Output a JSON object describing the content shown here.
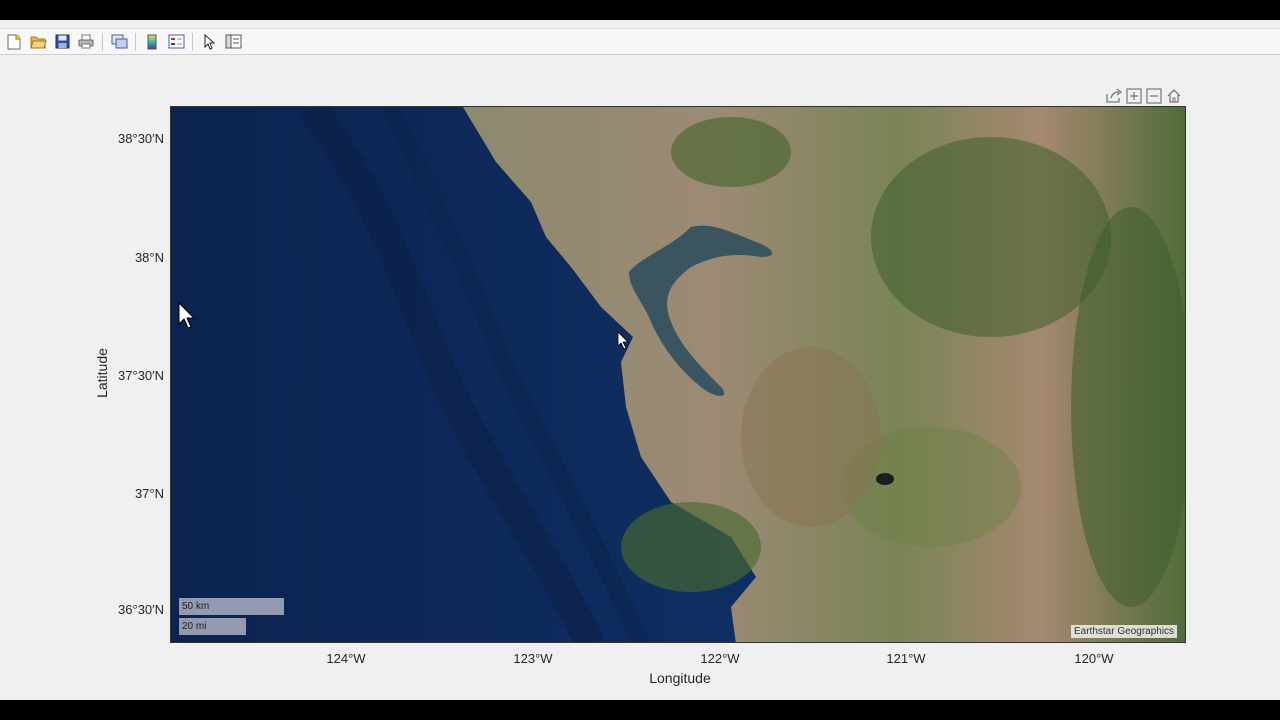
{
  "toolbar": {
    "buttons": [
      {
        "name": "new-figure-icon"
      },
      {
        "name": "open-file-icon"
      },
      {
        "name": "save-icon"
      },
      {
        "name": "print-icon"
      },
      {
        "name": "link-plot-icon"
      },
      {
        "name": "colorbar-icon"
      },
      {
        "name": "legend-icon"
      },
      {
        "name": "edit-plot-arrow-icon"
      },
      {
        "name": "property-inspector-icon"
      }
    ]
  },
  "axes_toolbar": [
    "export-icon",
    "zoom-in-icon",
    "zoom-out-icon",
    "home-icon"
  ],
  "map": {
    "basemap": "satellite",
    "attribution": "Earthstar Geographics",
    "scale_bar_km": "50 km",
    "scale_bar_mi": "20 mi",
    "lat_ticks": [
      "38°30′N",
      "38°N",
      "37°30′N",
      "37°N",
      "36°30′N"
    ],
    "lon_ticks": [
      "124°W",
      "123°W",
      "122°W",
      "121°W",
      "120°W"
    ],
    "ylabel": "Latitude",
    "xlabel": "Longitude",
    "colors": {
      "ocean": "#0f2a55",
      "land_dry": "#a48f76",
      "land_green": "#4d6b35",
      "bay": "#3b5560"
    }
  }
}
